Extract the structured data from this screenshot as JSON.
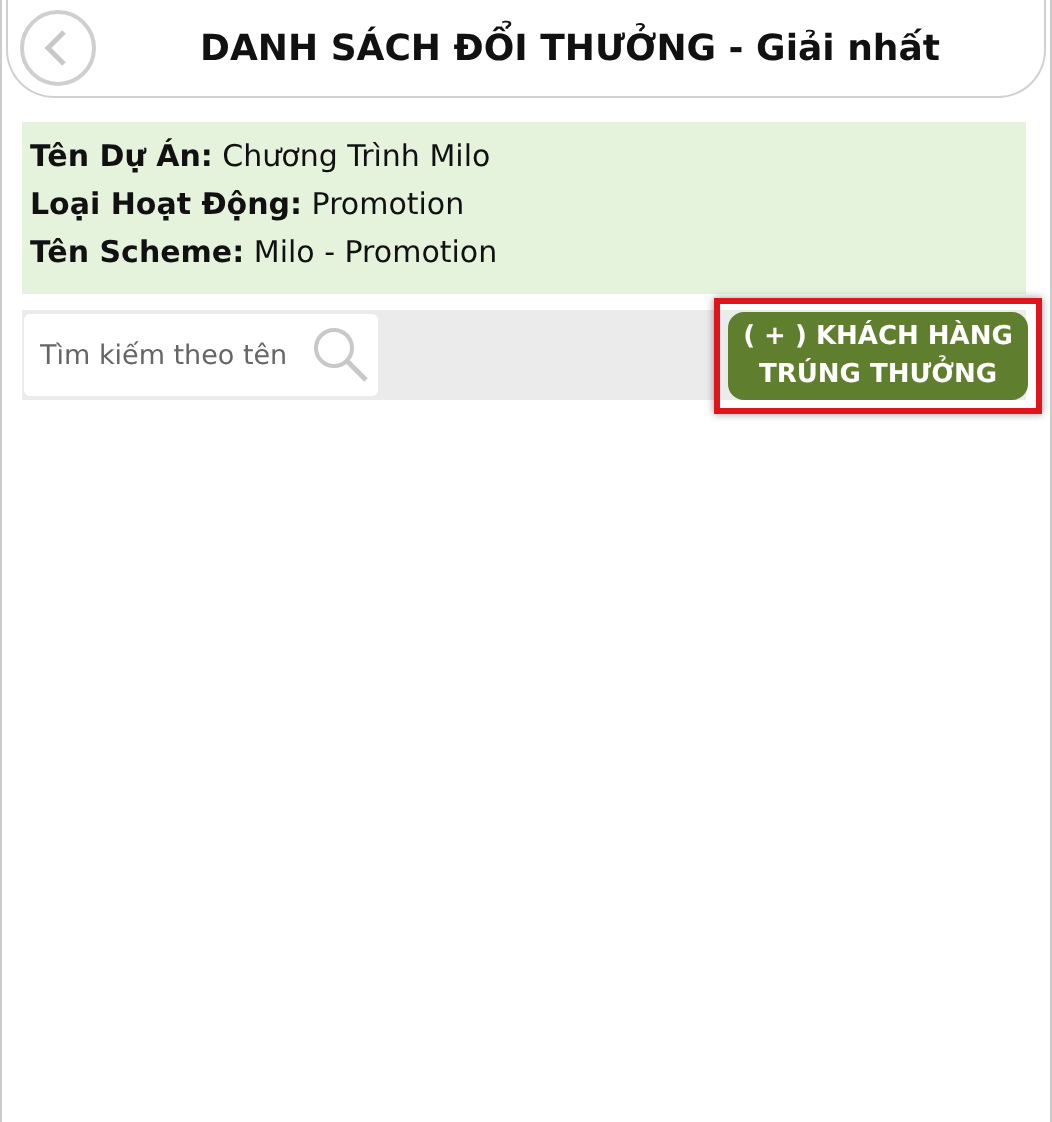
{
  "header": {
    "title": "DANH SÁCH ĐỔI THƯỞNG - Giải nhất"
  },
  "info": [
    {
      "label": "Tên Dự Án:",
      "value": "Chương Trình Milo"
    },
    {
      "label": "Loại Hoạt Động:",
      "value": "Promotion"
    },
    {
      "label": "Tên Scheme:",
      "value": "Milo - Promotion"
    }
  ],
  "search": {
    "placeholder": "Tìm kiếm theo tên"
  },
  "add_button": {
    "lines": [
      "( + ) KHÁCH HÀNG",
      "TRÚNG THƯỞNG"
    ],
    "highlighted": true
  }
}
